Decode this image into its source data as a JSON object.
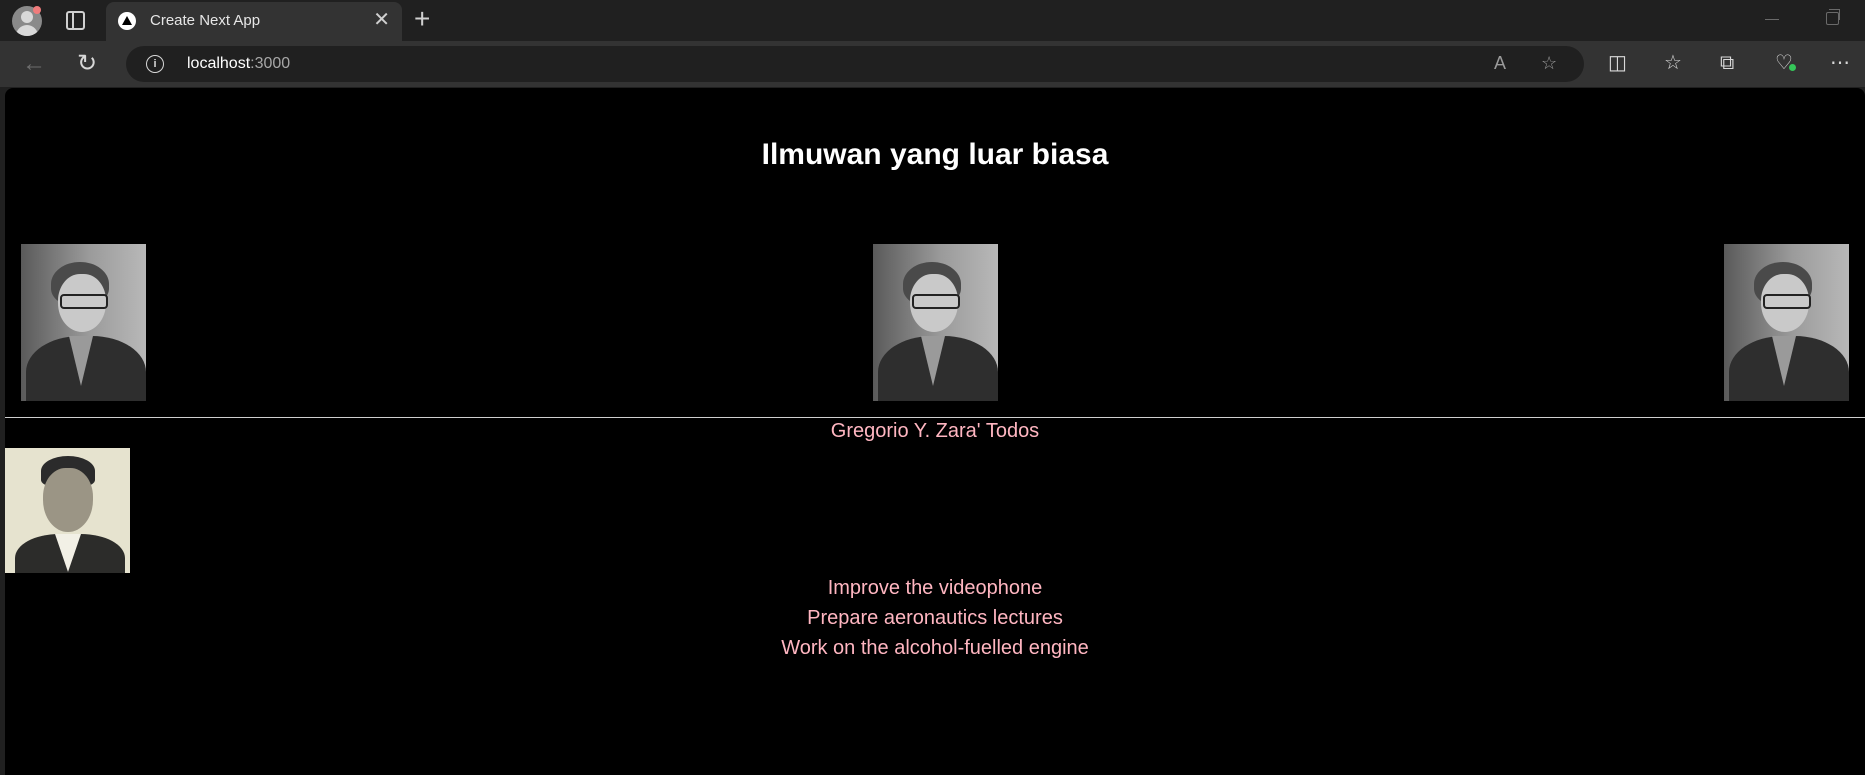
{
  "browser": {
    "tab_title": "Create Next App",
    "url_host": "localhost",
    "url_port": ":3000"
  },
  "page": {
    "heading": "Ilmuwan yang luar biasa",
    "scientist_name": "Gregorio Y. Zara' Todos",
    "todos": [
      "Improve the videophone",
      "Prepare aeronautics lectures",
      "Work on the alcohol-fuelled engine"
    ]
  },
  "icons": {
    "tabs": "tab-actions-icon",
    "new_tab": "plus-icon",
    "back": "back-arrow-icon",
    "reload": "reload-icon",
    "info": "info-icon",
    "read_aloud": "read-aloud-icon",
    "favorite": "star-icon",
    "split": "split-screen-icon",
    "favorites": "favorites-icon",
    "collections": "collections-icon",
    "performance": "heart-pulse-icon",
    "menu": "more-icon"
  },
  "colors": {
    "page_background": "#000000",
    "heading": "#ffffff",
    "text_accent": "#ffb6c1"
  }
}
